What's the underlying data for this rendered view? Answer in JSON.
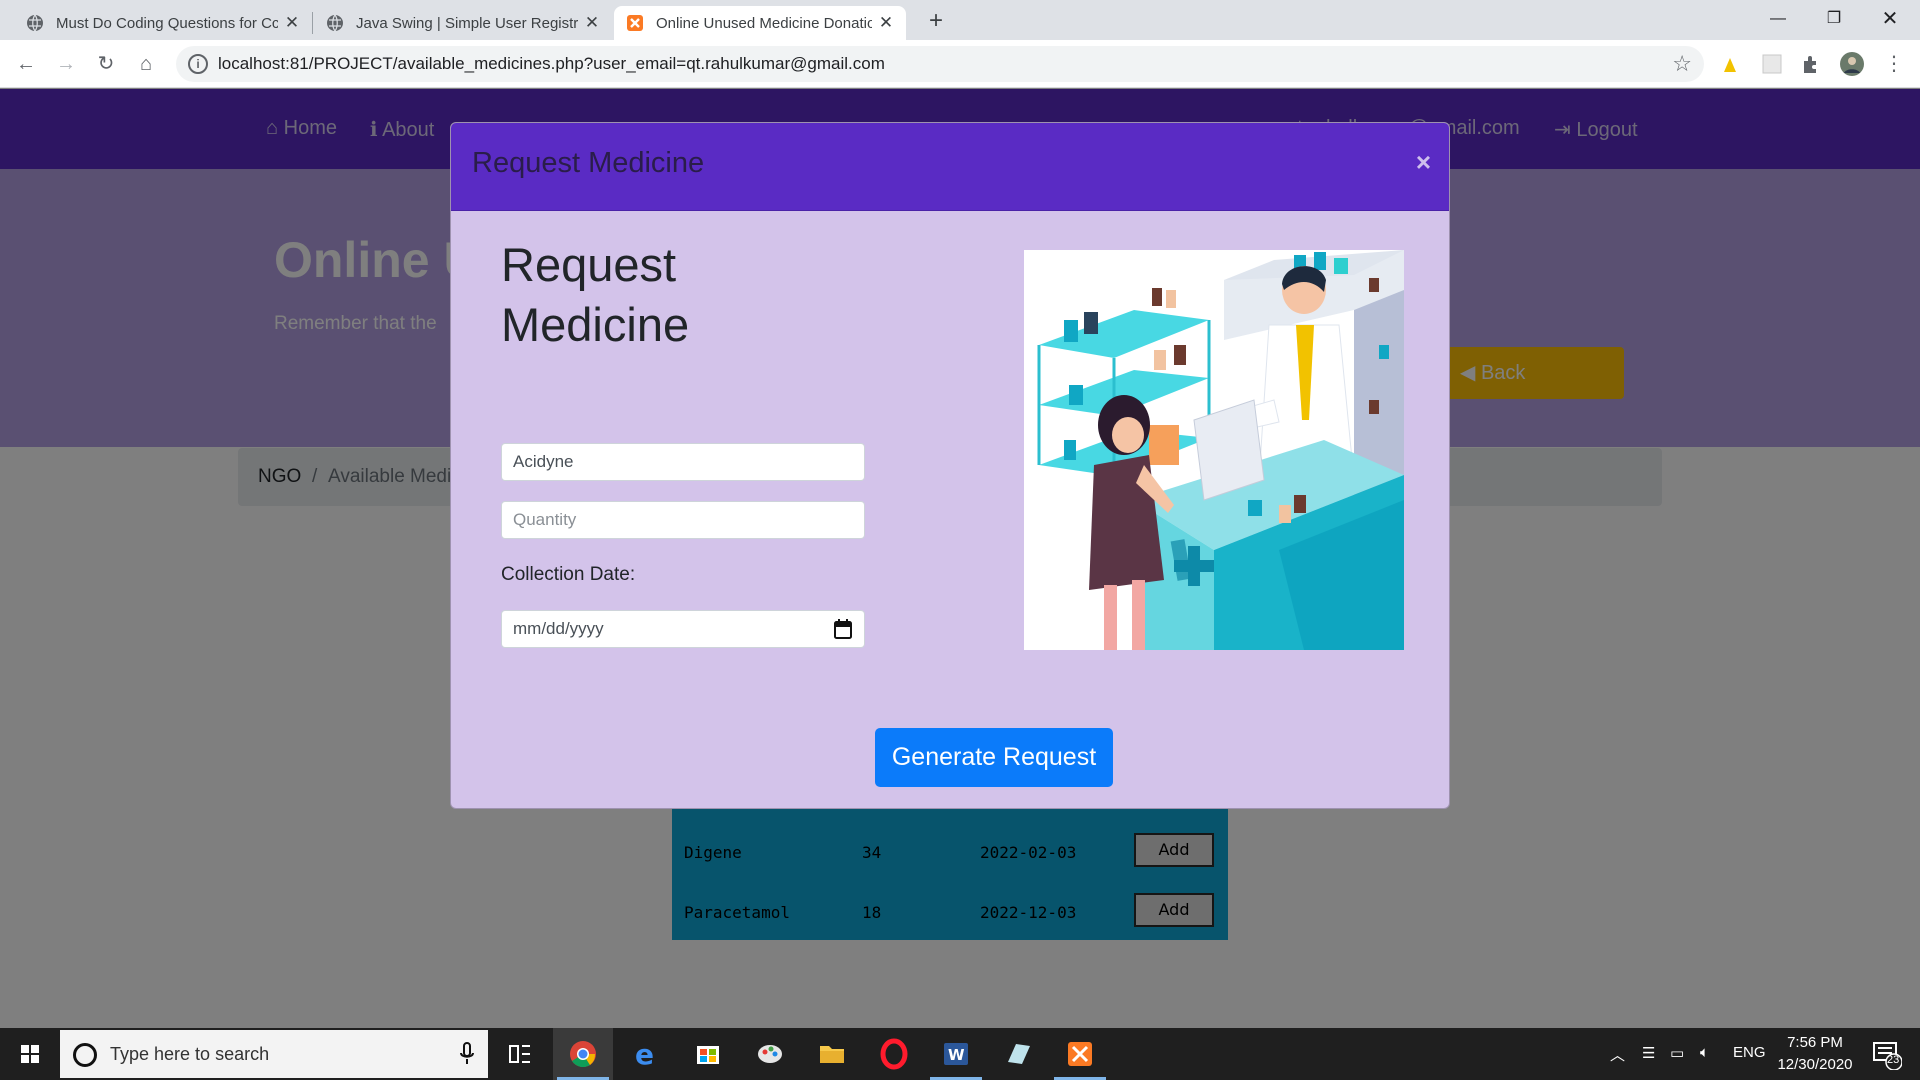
{
  "browser": {
    "tabs": [
      {
        "title": "Must Do Coding Questions for Cc",
        "active": false
      },
      {
        "title": "Java Swing | Simple User Registra",
        "active": false
      },
      {
        "title": "Online Unused Medicine Donatio",
        "active": true
      }
    ],
    "url": "localhost:81/PROJECT/available_medicines.php?user_email=qt.rahulkumar@gmail.com"
  },
  "site": {
    "nav": {
      "home": "Home",
      "about": "About",
      "user_email": "qt.rahulkumar@gmail.com",
      "logout": "Logout"
    },
    "hero": {
      "title": "Online Unused Medicine Donation",
      "subtitle": "Remember that the",
      "back_label": "Back"
    },
    "breadcrumb": {
      "root": "NGO",
      "sep": "/",
      "current": "Available Medicines"
    },
    "table_rows": [
      {
        "name": "Digene",
        "qty": "34",
        "expiry": "2022-02-03",
        "action": "Add"
      },
      {
        "name": "Paracetamol",
        "qty": "18",
        "expiry": "2022-12-03",
        "action": "Add"
      }
    ]
  },
  "modal": {
    "title": "Request Medicine",
    "close": "×",
    "heading_line1": "Request",
    "heading_line2": "Medicine",
    "medicine_value": "Acidyne",
    "quantity_placeholder": "Quantity",
    "collection_label": "Collection Date:",
    "date_placeholder": "mm/dd/yyyy",
    "submit_label": "Generate Request"
  },
  "taskbar": {
    "search_placeholder": "Type here to search",
    "language": "ENG",
    "time": "7:56 PM",
    "date": "12/30/2020",
    "notification_count": "23"
  },
  "colors": {
    "brand": "#5a2bc4",
    "modal_bg": "#d3c3ea",
    "primary": "#0b7bfa",
    "warning": "#ffc107"
  }
}
